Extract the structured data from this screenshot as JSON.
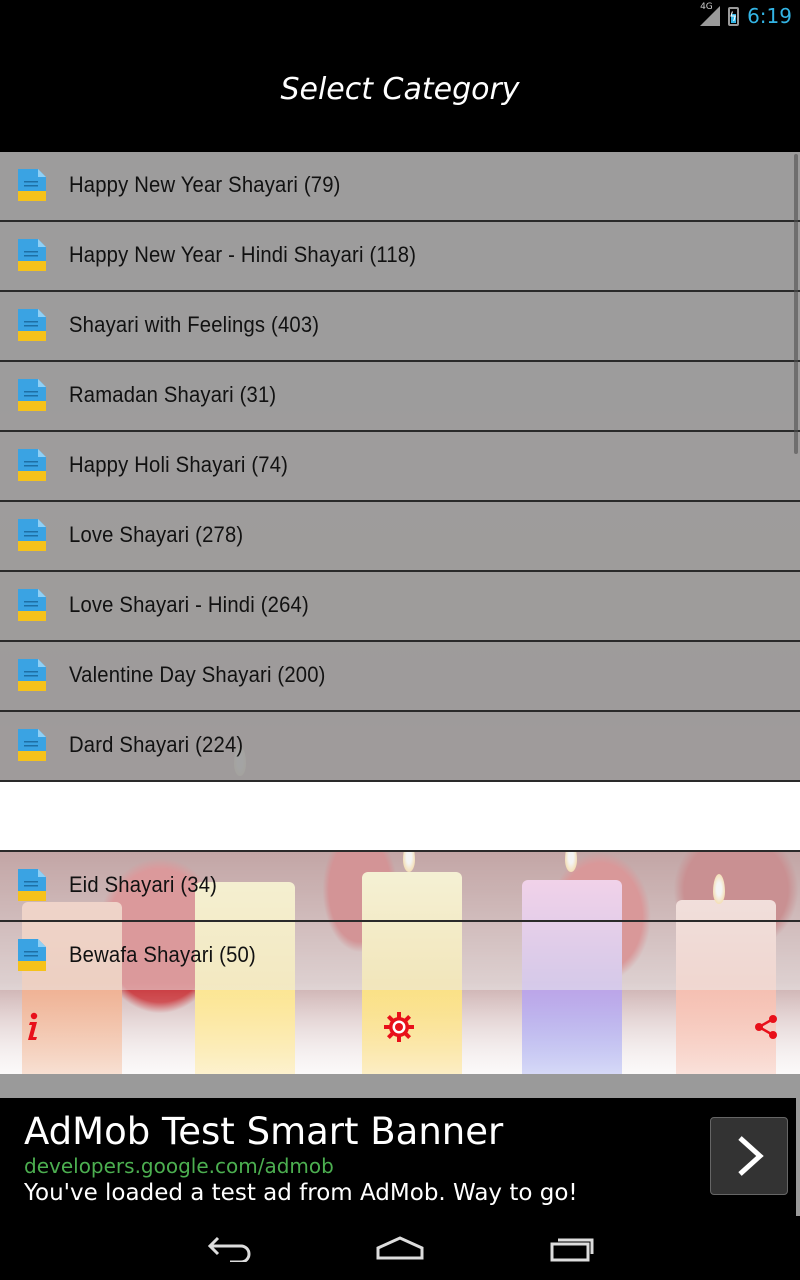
{
  "status_bar": {
    "network": "4G",
    "time": "6:19"
  },
  "header": {
    "title": "Select Category"
  },
  "categories": [
    {
      "label": "Happy New Year Shayari (79)",
      "icon": "document-icon"
    },
    {
      "label": "Happy New Year - Hindi Shayari (118)",
      "icon": "document-icon"
    },
    {
      "label": "Shayari with Feelings (403)",
      "icon": "document-icon"
    },
    {
      "label": "Ramadan Shayari (31)",
      "icon": "document-icon"
    },
    {
      "label": "Happy Holi Shayari (74)",
      "icon": "document-icon"
    },
    {
      "label": "Love Shayari (278)",
      "icon": "document-icon"
    },
    {
      "label": "Love Shayari - Hindi (264)",
      "icon": "document-icon"
    },
    {
      "label": "Valentine Day Shayari (200)",
      "icon": "document-icon"
    },
    {
      "label": "Dard Shayari (224)",
      "icon": "document-icon"
    },
    {
      "label": "",
      "icon": ""
    },
    {
      "label": "Eid Shayari (34)",
      "icon": "document-icon"
    },
    {
      "label": "Bewafa Shayari (50)",
      "icon": "document-icon"
    }
  ],
  "toolbar": {
    "info_icon": "info-icon",
    "settings_icon": "settings-gear-icon",
    "share_icon": "share-icon",
    "accent_color": "#e8101a"
  },
  "ad": {
    "title": "AdMob Test Smart Banner",
    "url": "developers.google.com/admob",
    "description": "You've loaded a test ad from AdMob. Way to go!",
    "button_icon": "chevron-right-icon",
    "url_color": "#4caf50"
  },
  "nav_bar": {
    "back_icon": "back-icon",
    "home_icon": "home-icon",
    "recents_icon": "recents-icon"
  },
  "colors": {
    "row_background": "#a0a0a0",
    "icon_blue": "#3aa3e3",
    "icon_yellow": "#f6c21a",
    "status_blue": "#33b5e5"
  }
}
